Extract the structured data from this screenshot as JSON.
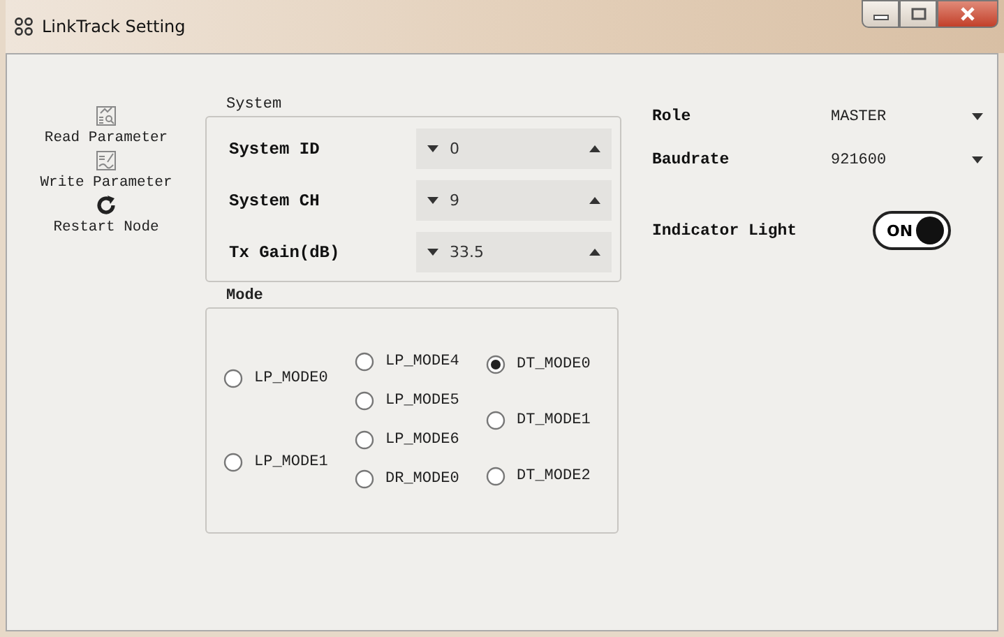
{
  "window": {
    "title": "LinkTrack Setting"
  },
  "toolbar": [
    {
      "kind": "read",
      "label": "Read Parameter"
    },
    {
      "kind": "write",
      "label": "Write Parameter"
    },
    {
      "kind": "restart",
      "label": "Restart Node"
    }
  ],
  "system": {
    "title": "System",
    "rows": [
      {
        "label": "System ID",
        "value": "0"
      },
      {
        "label": "System CH",
        "value": "9"
      },
      {
        "label": "Tx Gain(dB)",
        "value": "33.5"
      }
    ]
  },
  "mode": {
    "title": "Mode",
    "columns": [
      [
        {
          "label": "LP_MODE0",
          "selected": false
        },
        {
          "label": "LP_MODE1",
          "selected": false
        }
      ],
      [
        {
          "label": "LP_MODE4",
          "selected": false
        },
        {
          "label": "LP_MODE5",
          "selected": false
        },
        {
          "label": "LP_MODE6",
          "selected": false
        },
        {
          "label": "DR_MODE0",
          "selected": false
        }
      ],
      [
        {
          "label": "DT_MODE0",
          "selected": true
        },
        {
          "label": "DT_MODE1",
          "selected": false
        },
        {
          "label": "DT_MODE2",
          "selected": false
        }
      ]
    ]
  },
  "settings": [
    {
      "label": "Role",
      "value": "MASTER"
    },
    {
      "label": "Baudrate",
      "value": "921600"
    }
  ],
  "indicator": {
    "label": "Indicator Light",
    "toggle_text": "ON",
    "on": true
  }
}
